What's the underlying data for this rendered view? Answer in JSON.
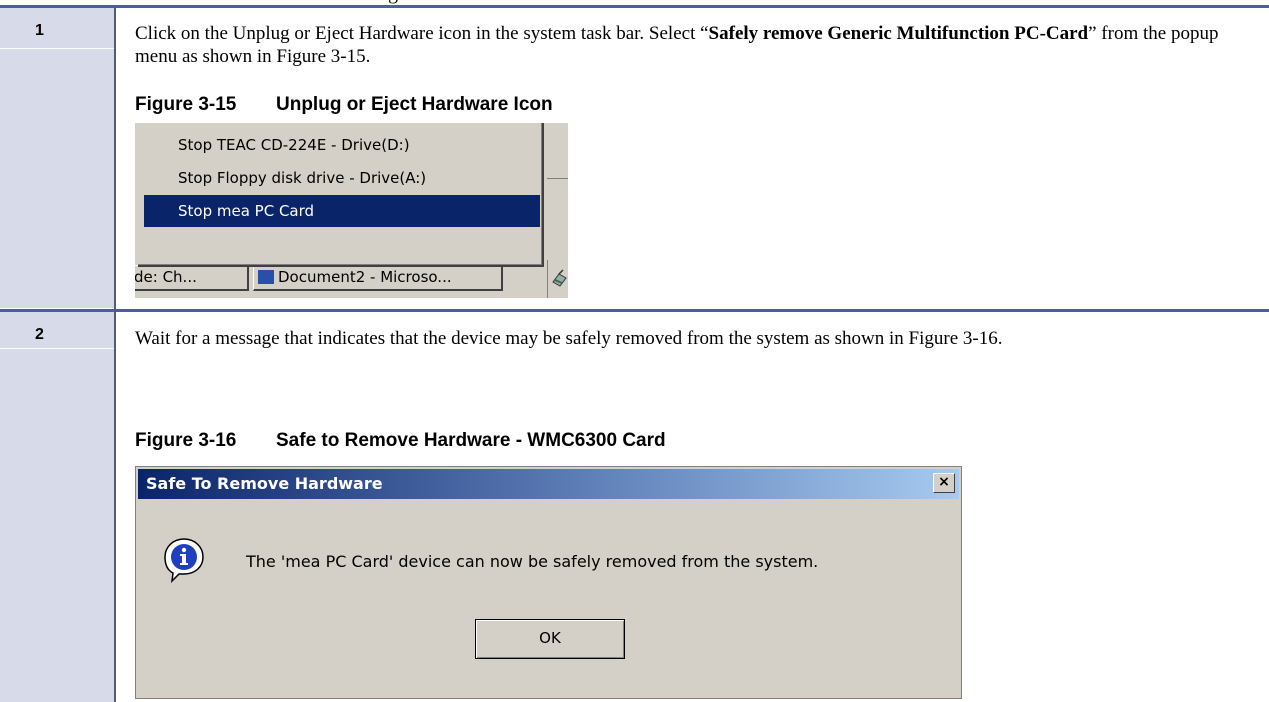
{
  "header_fragment": "g",
  "steps": [
    {
      "number": "1",
      "text_parts": [
        "Click on the Unplug or Eject Hardware icon in the system task bar.  Select “",
        "Safely remove Generic Multifunction PC-Card",
        "” from the popup menu as shown in Figure 3-15."
      ],
      "figure": {
        "label": "Figure 3-15",
        "title": "Unplug or Eject Hardware Icon",
        "menu_items": [
          "Stop TEAC CD-224E - Drive(D:)",
          "Stop Floppy disk drive - Drive(A:)",
          "Stop mea PC Card"
        ],
        "selected_index": 2,
        "taskbar_buttons": [
          "de: Ch...",
          "Document2 - Microso..."
        ],
        "icons": [
          "document-icon",
          "eject-hardware-icon"
        ]
      }
    },
    {
      "number": "2",
      "text": "Wait for a message that indicates that the device may be safely removed from the system as shown in Figure 3-16.",
      "figure": {
        "label": "Figure 3-16",
        "title": "Safe to Remove Hardware - WMC6300 Card",
        "dialog_title": "Safe To Remove Hardware",
        "close_glyph": "×",
        "message": "The 'mea PC Card' device can now be safely removed from the system.",
        "ok_label": "OK",
        "icons": [
          "info-icon",
          "close-icon"
        ]
      }
    }
  ],
  "colors": {
    "rule": "#4b5fa0",
    "number_column": "#d7dbe9",
    "menu_highlight": "#0a246a",
    "dialog_bg": "#d4d0c8"
  }
}
